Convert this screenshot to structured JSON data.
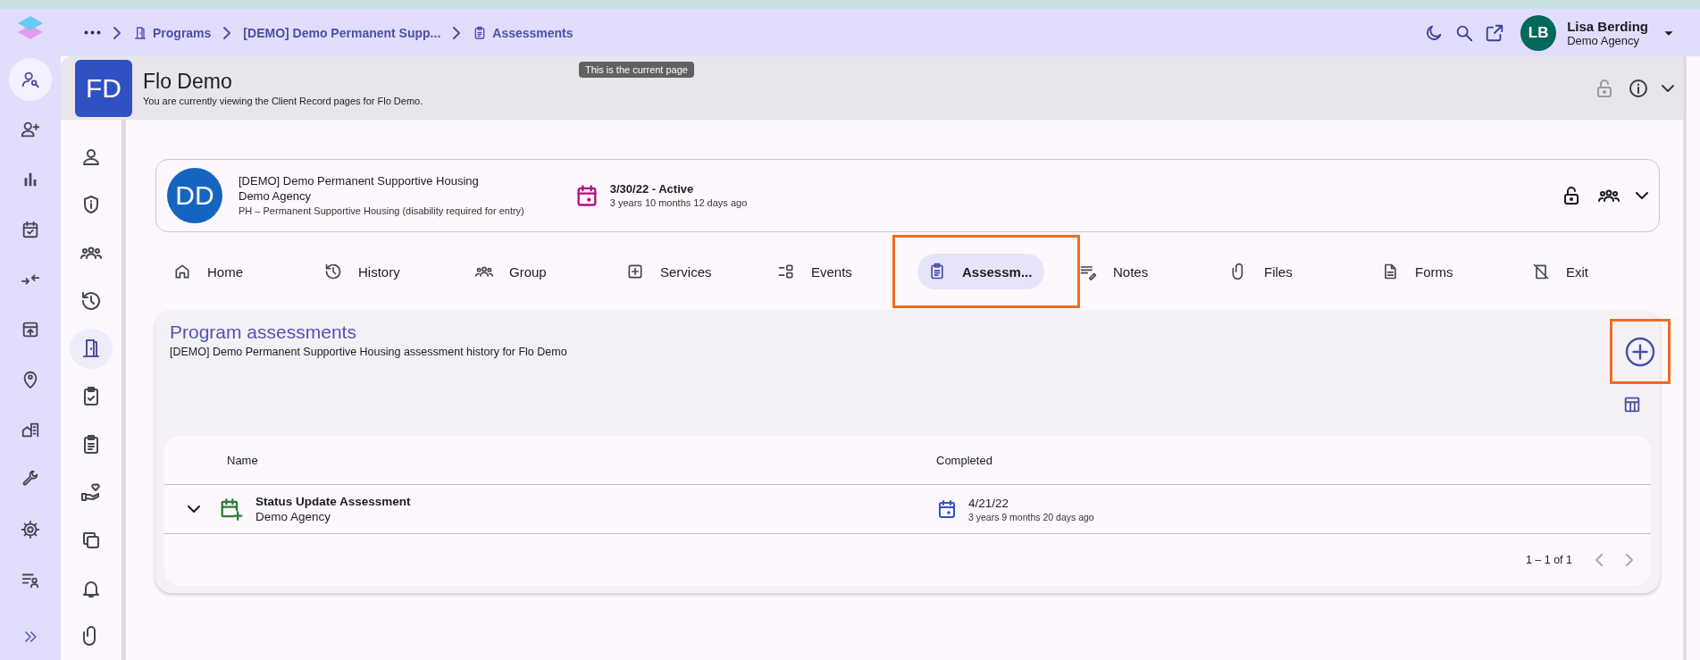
{
  "breadcrumbs": {
    "items": [
      {
        "label": "Programs"
      },
      {
        "label": "[DEMO] Demo Permanent Supp..."
      },
      {
        "label": "Assessments"
      }
    ],
    "tooltip": "This is the current page"
  },
  "user": {
    "initials": "LB",
    "name": "Lisa Berding",
    "agency": "Demo Agency"
  },
  "rail": [
    {
      "selected": true
    },
    {
      "selected": false
    },
    {
      "selected": false
    },
    {
      "selected": false
    },
    {
      "selected": false
    },
    {
      "selected": false
    },
    {
      "selected": false
    },
    {
      "selected": false
    },
    {
      "selected": false
    },
    {
      "selected": false
    },
    {
      "selected": false
    }
  ],
  "client": {
    "initials": "FD",
    "name": "Flo Demo",
    "subtitle": "You are currently viewing the Client Record pages for Flo Demo."
  },
  "client_nav": [
    {
      "selected": false
    },
    {
      "selected": false
    },
    {
      "selected": false
    },
    {
      "selected": false
    },
    {
      "selected": true
    },
    {
      "selected": false
    },
    {
      "selected": false
    },
    {
      "selected": false
    },
    {
      "selected": false
    },
    {
      "selected": false
    },
    {
      "selected": false
    }
  ],
  "enrollment": {
    "initials": "DD",
    "program": "[DEMO] Demo Permanent Supportive Housing",
    "agency": "Demo Agency",
    "project_type": "PH – Permanent Supportive Housing (disability required for entry)",
    "date_status": "3/30/22 - Active",
    "duration": "3 years 10 months 12 days ago"
  },
  "tabs": [
    {
      "label": "Home",
      "selected": false,
      "highlighted": false
    },
    {
      "label": "History",
      "selected": false,
      "highlighted": false
    },
    {
      "label": "Group",
      "selected": false,
      "highlighted": false
    },
    {
      "label": "Services",
      "selected": false,
      "highlighted": false
    },
    {
      "label": "Events",
      "selected": false,
      "highlighted": false
    },
    {
      "label": "Assessm...",
      "selected": true,
      "highlighted": true
    },
    {
      "label": "Notes",
      "selected": false,
      "highlighted": false
    },
    {
      "label": "Files",
      "selected": false,
      "highlighted": false
    },
    {
      "label": "Forms",
      "selected": false,
      "highlighted": false
    },
    {
      "label": "Exit",
      "selected": false,
      "highlighted": false
    }
  ],
  "assessments": {
    "title": "Program assessments",
    "subtitle": "[DEMO] Demo Permanent Supportive Housing assessment history for Flo Demo",
    "add_highlighted": true,
    "columns": [
      "Name",
      "Completed"
    ],
    "rows": [
      {
        "name": "Status Update Assessment",
        "agency": "Demo Agency",
        "completed": "4/21/22",
        "ago": "3 years 9 months 20 days ago",
        "expanded": false
      }
    ],
    "pagination": "1 – 1 of 1",
    "prev_disabled": true,
    "next_disabled": true
  }
}
